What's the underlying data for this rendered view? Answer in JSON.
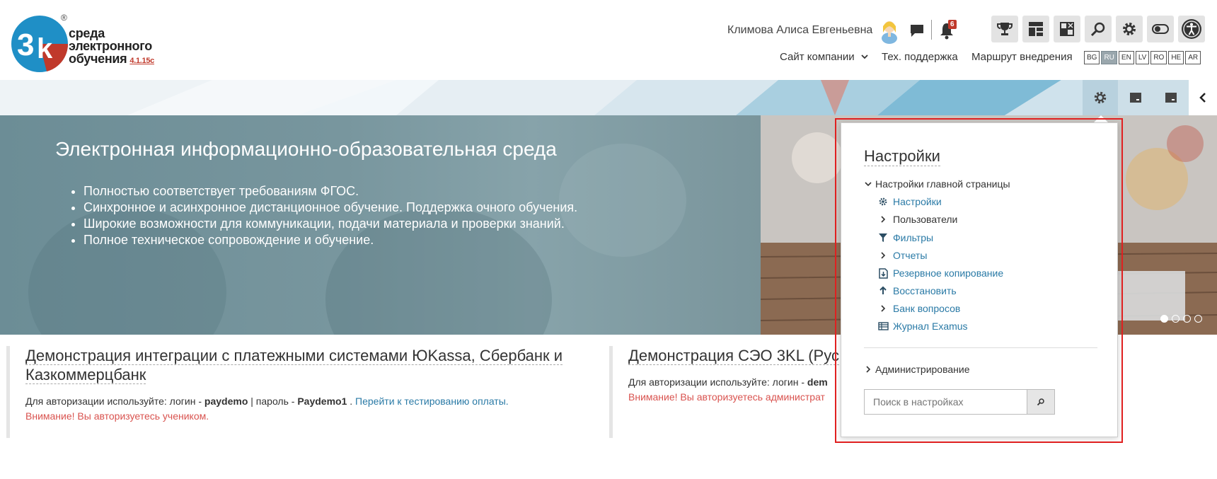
{
  "header": {
    "logo": {
      "line1": "среда",
      "line2": "электронного",
      "line3": "обучения",
      "version": "4.1.15c",
      "reg": "®"
    },
    "user_name": "Климова Алиса Евгеньевна",
    "notification_count": "6",
    "nav": {
      "company_site": "Сайт компании",
      "support": "Тех. поддержка",
      "route": "Маршрут внедрения"
    },
    "languages": [
      "BG",
      "RU",
      "EN",
      "LV",
      "RO",
      "HE",
      "AR"
    ],
    "active_language": "RU",
    "toolbar_icons": [
      "trophy-icon",
      "dashboard-icon",
      "layout-icon",
      "search-icon",
      "gear-icon",
      "toggle-icon",
      "accessibility-icon"
    ]
  },
  "hero": {
    "title": "Электронная информационно-образовательная среда",
    "bullets": [
      "Полностью соответствует требованиям ФГОС.",
      "Синхронное и асинхронное дистанционное обучение. Поддержка очного обучения.",
      "Широкие возможности для коммуникации, подачи материала и проверки знаний.",
      "Полное техническое сопровождение и обучение."
    ],
    "slides_total": 4,
    "slide_active": 1
  },
  "cards": {
    "left": {
      "title_line1": "Демонстрация интеграции с платежными системами ЮKassa, Сбербанк и",
      "title_line2": "Казкоммерцбанк",
      "text_prefix": "Для авторизации используйте: логин - ",
      "login": "paydemo",
      "text_mid": " | пароль - ",
      "password": "Paydemo1",
      "text_space": " . ",
      "link": "Перейти к тестированию оплаты.",
      "warning": "Внимание! Вы авторизуетесь учеником."
    },
    "right": {
      "title": "Демонстрация СЭО 3KL (Рус",
      "text_prefix": "Для авторизации используйте: логин - ",
      "login": "dem",
      "warning": "Внимание! Вы авторизуетесь администрат"
    }
  },
  "settings_popover": {
    "title": "Настройки",
    "section_home": "Настройки главной страницы",
    "items": {
      "settings": "Настройки",
      "users": "Пользователи",
      "filters": "Фильтры",
      "reports": "Отчеты",
      "backup": "Резервное копирование",
      "restore": "Восстановить",
      "question_bank": "Банк вопросов",
      "examus": "Журнал Examus"
    },
    "section_admin": "Администрирование",
    "search_placeholder": "Поиск в настройках"
  },
  "colors": {
    "accent_link": "#2a7aa6",
    "warning": "#d9534f",
    "highlight_border": "#e02020",
    "badge": "#c0392b"
  }
}
